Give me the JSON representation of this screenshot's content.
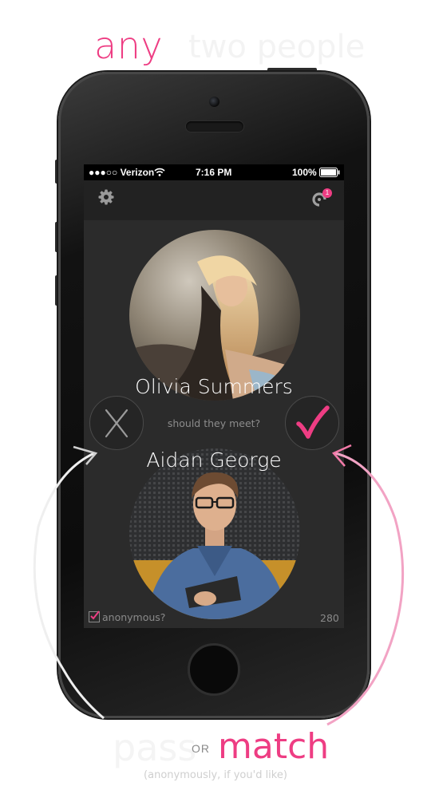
{
  "promo": {
    "headline": "any",
    "headline_faint": "two people",
    "pass_label": "pass",
    "or_label": "OR",
    "match_label": "match",
    "subtitle": "(anonymously, if you'd like)"
  },
  "status_bar": {
    "carrier": "●●●○○ Verizon",
    "time": "7:16 PM",
    "battery": "100%"
  },
  "toolbar": {
    "settings_icon": "gear-icon",
    "notifications_icon": "notification-icon",
    "notification_count": "1"
  },
  "match": {
    "person_top": "Olivia Summers",
    "question": "should they meet?",
    "person_bottom": "Aidan George",
    "pass_icon": "x-icon",
    "match_icon": "checkmark-icon"
  },
  "footer": {
    "anonymous_label": "anonymous?",
    "anonymous_checked": true,
    "counter": "280"
  },
  "colors": {
    "accent": "#ee3d83",
    "screen_bg": "#2b2b2b",
    "toolbar_bg": "#222222"
  }
}
